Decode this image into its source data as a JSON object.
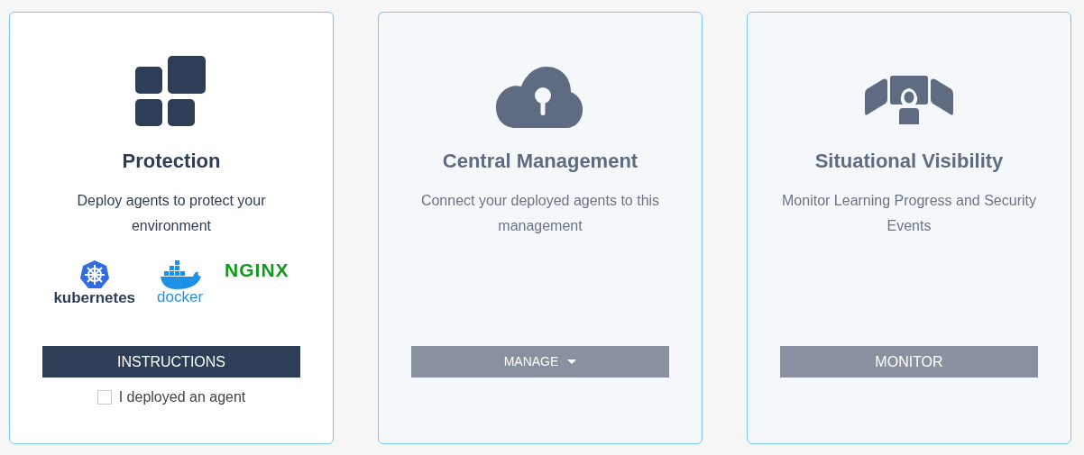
{
  "cards": [
    {
      "kind": "protection",
      "active": true,
      "title": "Protection",
      "description": "Deploy agents to protect your environment",
      "logos": [
        {
          "kind": "kubernetes",
          "text": "kubernetes"
        },
        {
          "kind": "docker",
          "text": "docker"
        },
        {
          "kind": "nginx",
          "text": "NGINX"
        }
      ],
      "button": {
        "label": "INSTRUCTIONS",
        "has_menu": false
      },
      "checkbox": {
        "label": "I deployed an agent",
        "checked": false
      }
    },
    {
      "kind": "management",
      "active": false,
      "title": "Central Management",
      "description": "Connect your deployed agents to this management",
      "button": {
        "label": "MANAGE",
        "has_menu": true
      }
    },
    {
      "kind": "visibility",
      "active": false,
      "title": "Situational Visibility",
      "description": "Monitor Learning Progress and Security Events",
      "button": {
        "label": "MONITOR",
        "has_menu": false
      }
    }
  ]
}
